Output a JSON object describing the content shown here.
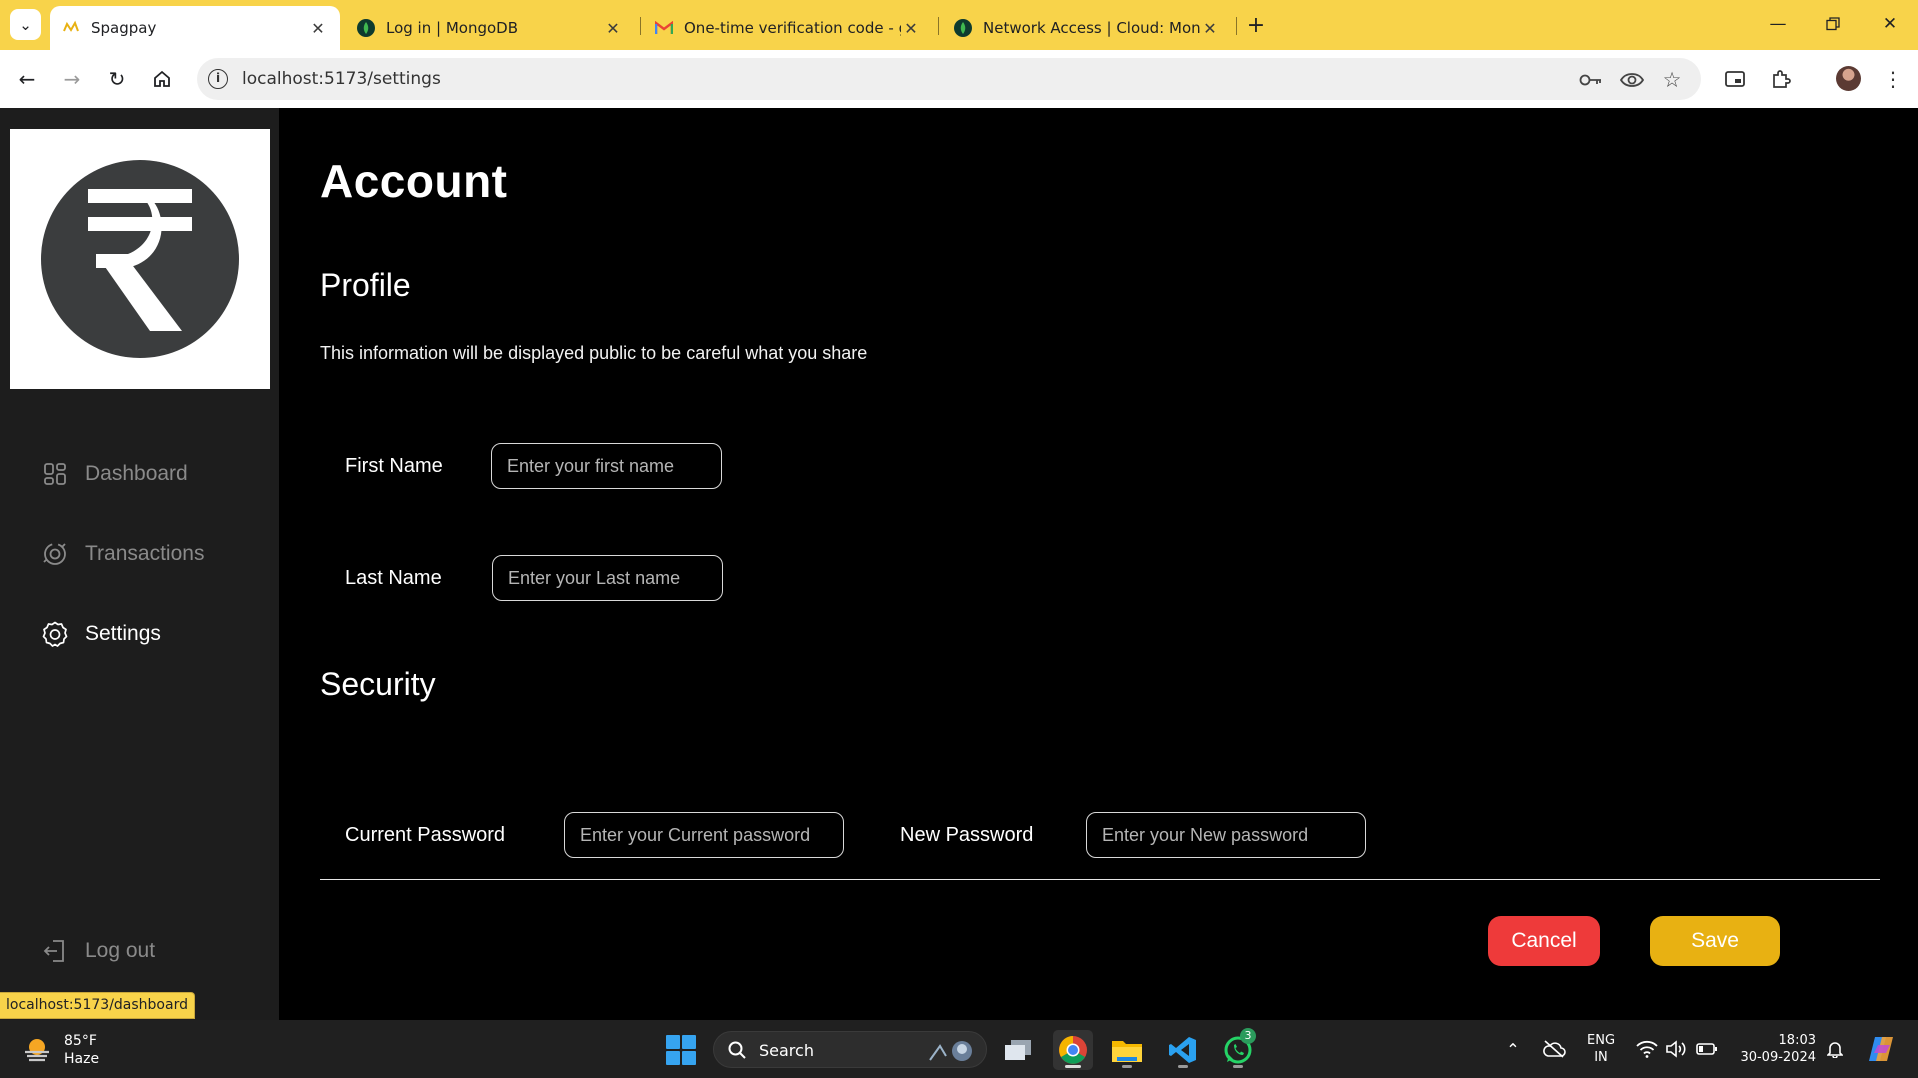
{
  "browser": {
    "tabs": [
      {
        "title": "Spagpay",
        "active": true
      },
      {
        "title": "Log in | MongoDB",
        "active": false
      },
      {
        "title": "One-time verification code - gu",
        "active": false
      },
      {
        "title": "Network Access | Cloud: Mongo",
        "active": false
      }
    ],
    "url": "localhost:5173/settings",
    "status_url": "localhost:5173/dashboard"
  },
  "sidebar": {
    "items": [
      {
        "label": "Dashboard",
        "icon": "dashboard-icon"
      },
      {
        "label": "Transactions",
        "icon": "transactions-icon"
      },
      {
        "label": "Settings",
        "icon": "gear-icon"
      }
    ],
    "logout_label": "Log out",
    "logo_icon": "rupee-icon"
  },
  "page": {
    "title": "Account",
    "profile": {
      "heading": "Profile",
      "description": "This information will be displayed public to be careful what you share",
      "first_name": {
        "label": "First Name",
        "value": "",
        "placeholder": "Enter your first name"
      },
      "last_name": {
        "label": "Last Name",
        "value": "",
        "placeholder": "Enter your Last name"
      }
    },
    "security": {
      "heading": "Security",
      "current_password": {
        "label": "Current Password",
        "value": "",
        "placeholder": "Enter your Current password"
      },
      "new_password": {
        "label": "New Password",
        "value": "",
        "placeholder": "Enter your New password"
      }
    },
    "actions": {
      "cancel_label": "Cancel",
      "save_label": "Save"
    }
  },
  "taskbar": {
    "weather": {
      "temp": "85°F",
      "condition": "Haze"
    },
    "search_label": "Search",
    "whatsapp_badge": "3",
    "lang_line1": "ENG",
    "lang_line2": "IN",
    "time": "18:03",
    "date": "30-09-2024"
  },
  "colors": {
    "browser_frame": "#f8d34a",
    "sidebar_bg": "#1d1d1d",
    "main_bg": "#000000",
    "cancel": "#ee3a3a",
    "save": "#e8b112",
    "logo_circle": "#3b3d3e"
  }
}
